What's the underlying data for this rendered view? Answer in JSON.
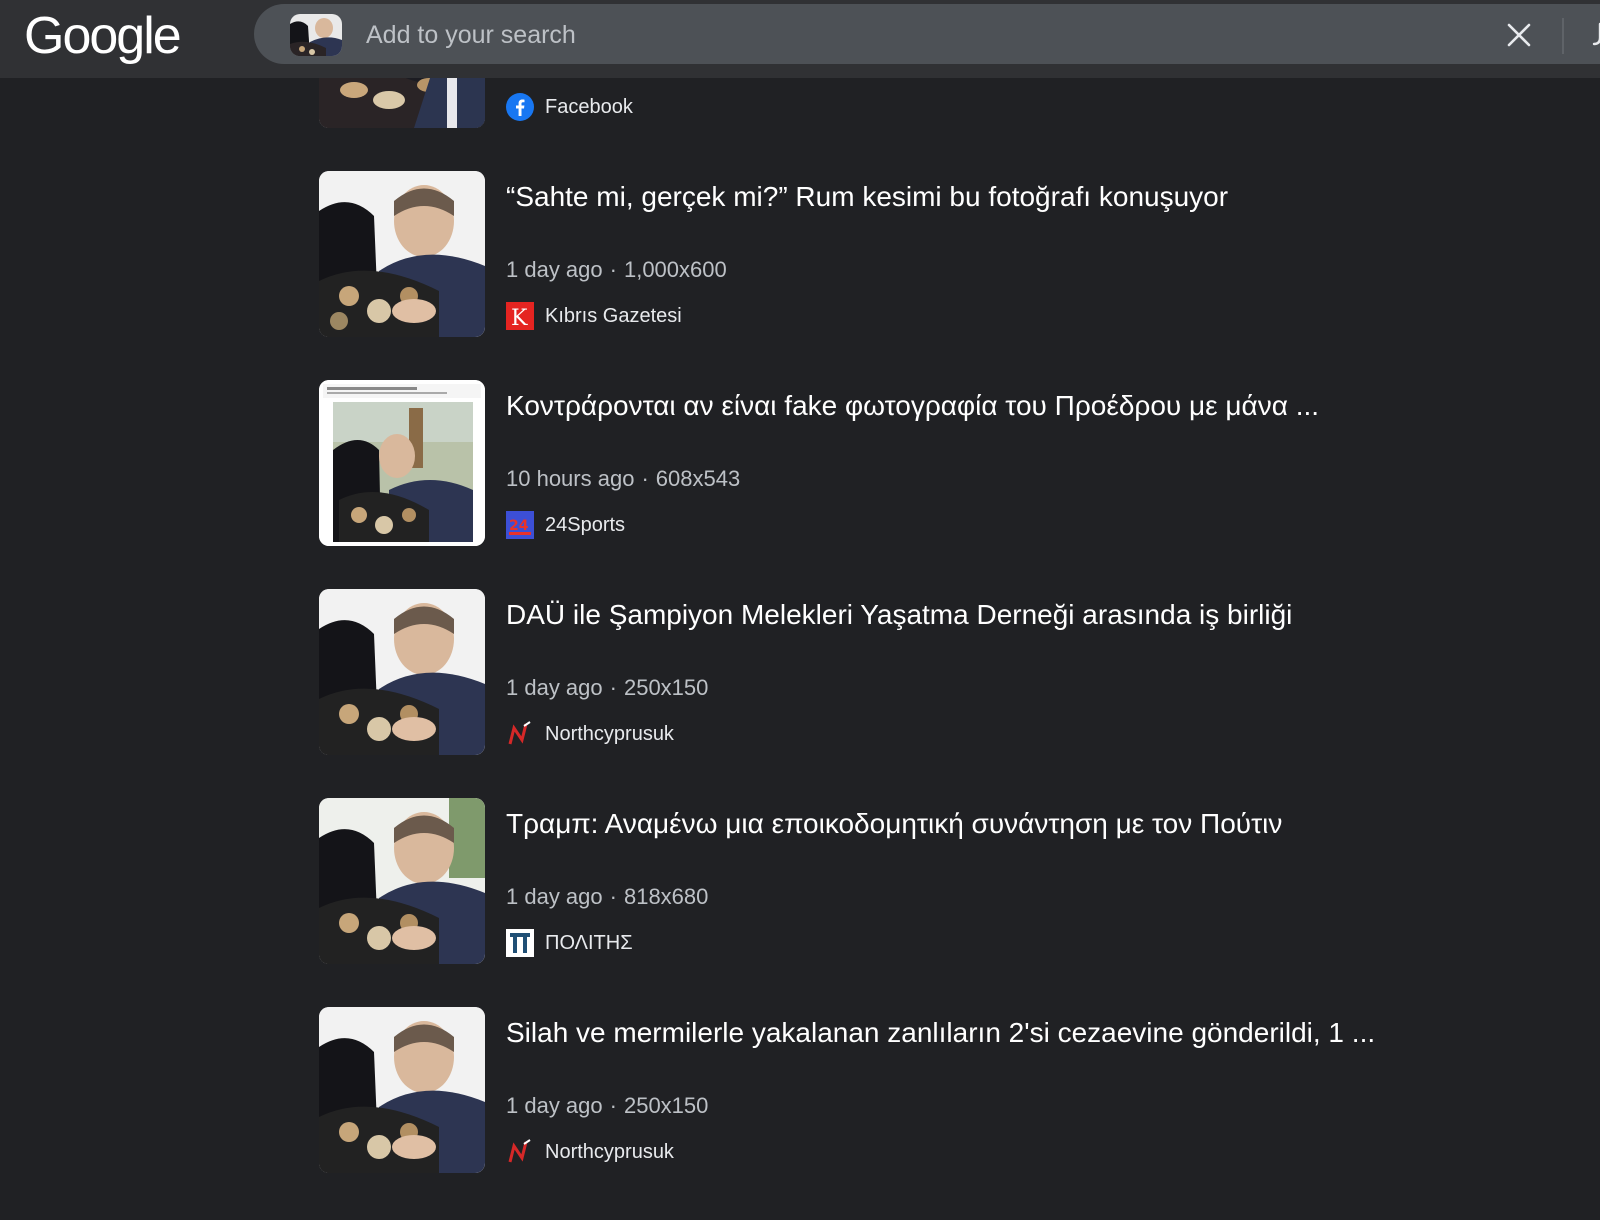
{
  "header": {
    "logo": "Google",
    "search_placeholder": "Add to your search"
  },
  "partial_result": {
    "source": "Facebook"
  },
  "results": [
    {
      "title": "“Sahte mi, gerçek mi?” Rum kesimi bu fotoğrafı konuşuyor",
      "time": "1 day ago",
      "dims": "1,000x600",
      "source": "Kıbrıs Gazetesi"
    },
    {
      "title": "Κοντράρονται αν είναι fake φωτογραφία του Προέδρου με μάνα ...",
      "time": "10 hours ago",
      "dims": "608x543",
      "source": "24Sports"
    },
    {
      "title": "DAÜ ile Şampiyon Melekleri Yaşatma Derneği arasında iş birliği",
      "time": "1 day ago",
      "dims": "250x150",
      "source": "Northcyprusuk"
    },
    {
      "title": "Τραμπ: Αναμένω μια εποικοδομητική συνάντηση με τον Πούτιν",
      "time": "1 day ago",
      "dims": "818x680",
      "source": "ΠΟΛΙΤΗΣ"
    },
    {
      "title": "Silah ve mermilerle yakalanan zanlıların 2'si cezaevine gönderildi, 1 ...",
      "time": "1 day ago",
      "dims": "250x150",
      "source": "Northcyprusuk"
    }
  ],
  "colors": {
    "background": "#202124",
    "topbar": "#303134",
    "searchbox": "#4d5156",
    "meta_text": "#bdc1c6"
  },
  "icons": {
    "clear": "close-icon",
    "facebook": "facebook-icon",
    "kibris": "kibris-gazetesi-icon",
    "sports24": "24sports-icon",
    "northcyprus": "northcyprusuk-icon",
    "politis": "politis-icon"
  }
}
